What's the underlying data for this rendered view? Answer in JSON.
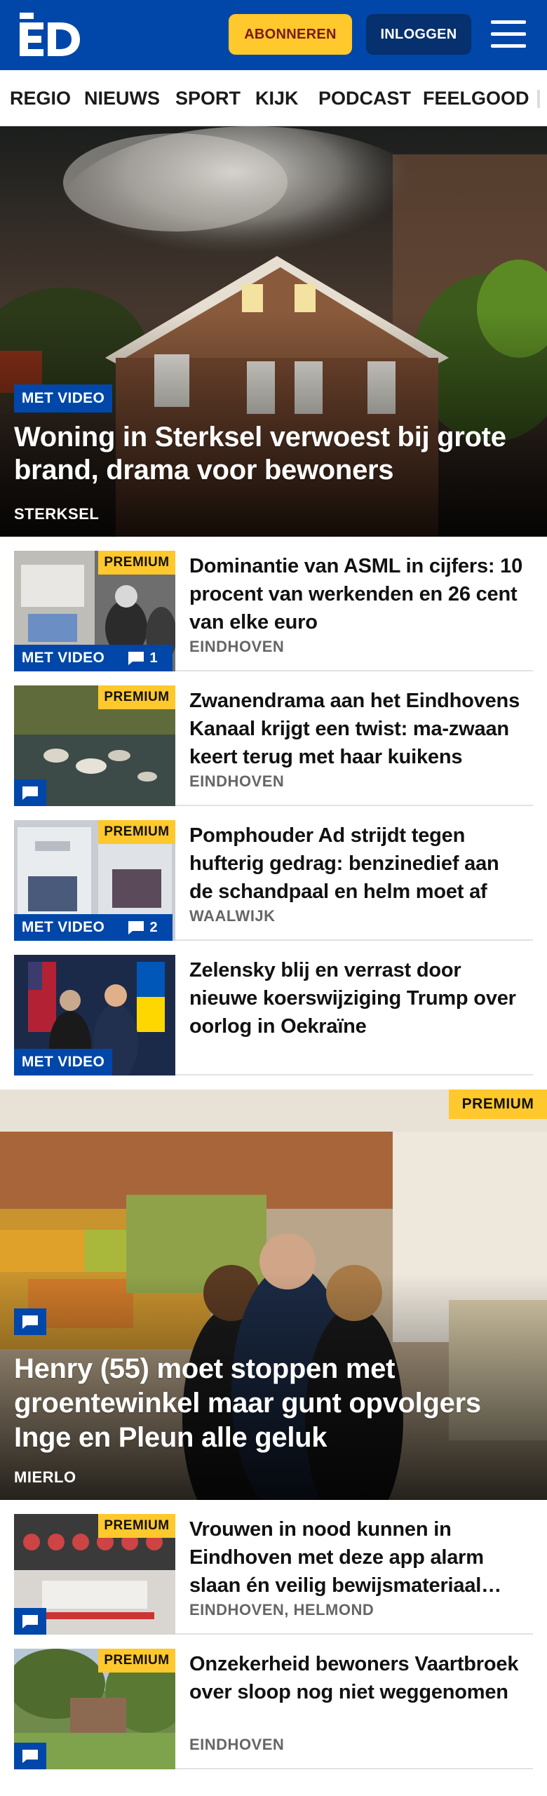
{
  "header": {
    "logo_text": "ED",
    "subscribe_label": "ABONNEREN",
    "login_label": "INLOGGEN",
    "menu_icon": "hamburger-icon",
    "bg_color": "#0047a9",
    "subscribe_color": "#ffc82c"
  },
  "nav": {
    "items": [
      "REGIO",
      "NIEUWS",
      "SPORT",
      "KIJK",
      "PODCAST",
      "FEELGOOD"
    ]
  },
  "hero": {
    "badge": "MET VIDEO",
    "title": "Woning in Sterksel verwoest bij grote brand, drama voor bewoners",
    "location": "STERKSEL"
  },
  "articles": [
    {
      "title": "Dominantie van ASML in cijfers: 10 procent van werkenden en 26 cent van elke euro",
      "location": "EINDHOVEN",
      "premium": "PREMIUM",
      "video": "MET VIDEO",
      "comments": "1"
    },
    {
      "title": "Zwanendrama aan het Eindhovens Kanaal krijgt een twist: ma-zwaan keert terug met haar kuikens",
      "location": "EINDHOVEN",
      "premium": "PREMIUM"
    },
    {
      "title": "Pomphouder Ad strijdt tegen hufterig gedrag: benzinedief aan de schandpaal en helm moet af",
      "location": "WAALWIJK",
      "premium": "PREMIUM",
      "video": "MET VIDEO",
      "comments": "2"
    },
    {
      "title": "Zelensky blij en verrast door nieuwe koerswijziging Trump over oorlog in Oekraïne",
      "video": "MET VIDEO"
    }
  ],
  "feature": {
    "premium": "PREMIUM",
    "title": "Henry (55) moet stoppen met groentewinkel maar gunt opvolgers Inge en Pleun alle geluk",
    "location": "MIERLO"
  },
  "articles2": [
    {
      "title": "Vrouwen in nood kunnen in Eindhoven met deze app alarm slaan én veilig bewijsmateriaal verzamelen",
      "location": "EINDHOVEN, HELMOND",
      "premium": "PREMIUM"
    },
    {
      "title": "Onzekerheid bewoners Vaartbroek over sloop nog niet weggenomen",
      "location": "EINDHOVEN",
      "premium": "PREMIUM"
    }
  ]
}
